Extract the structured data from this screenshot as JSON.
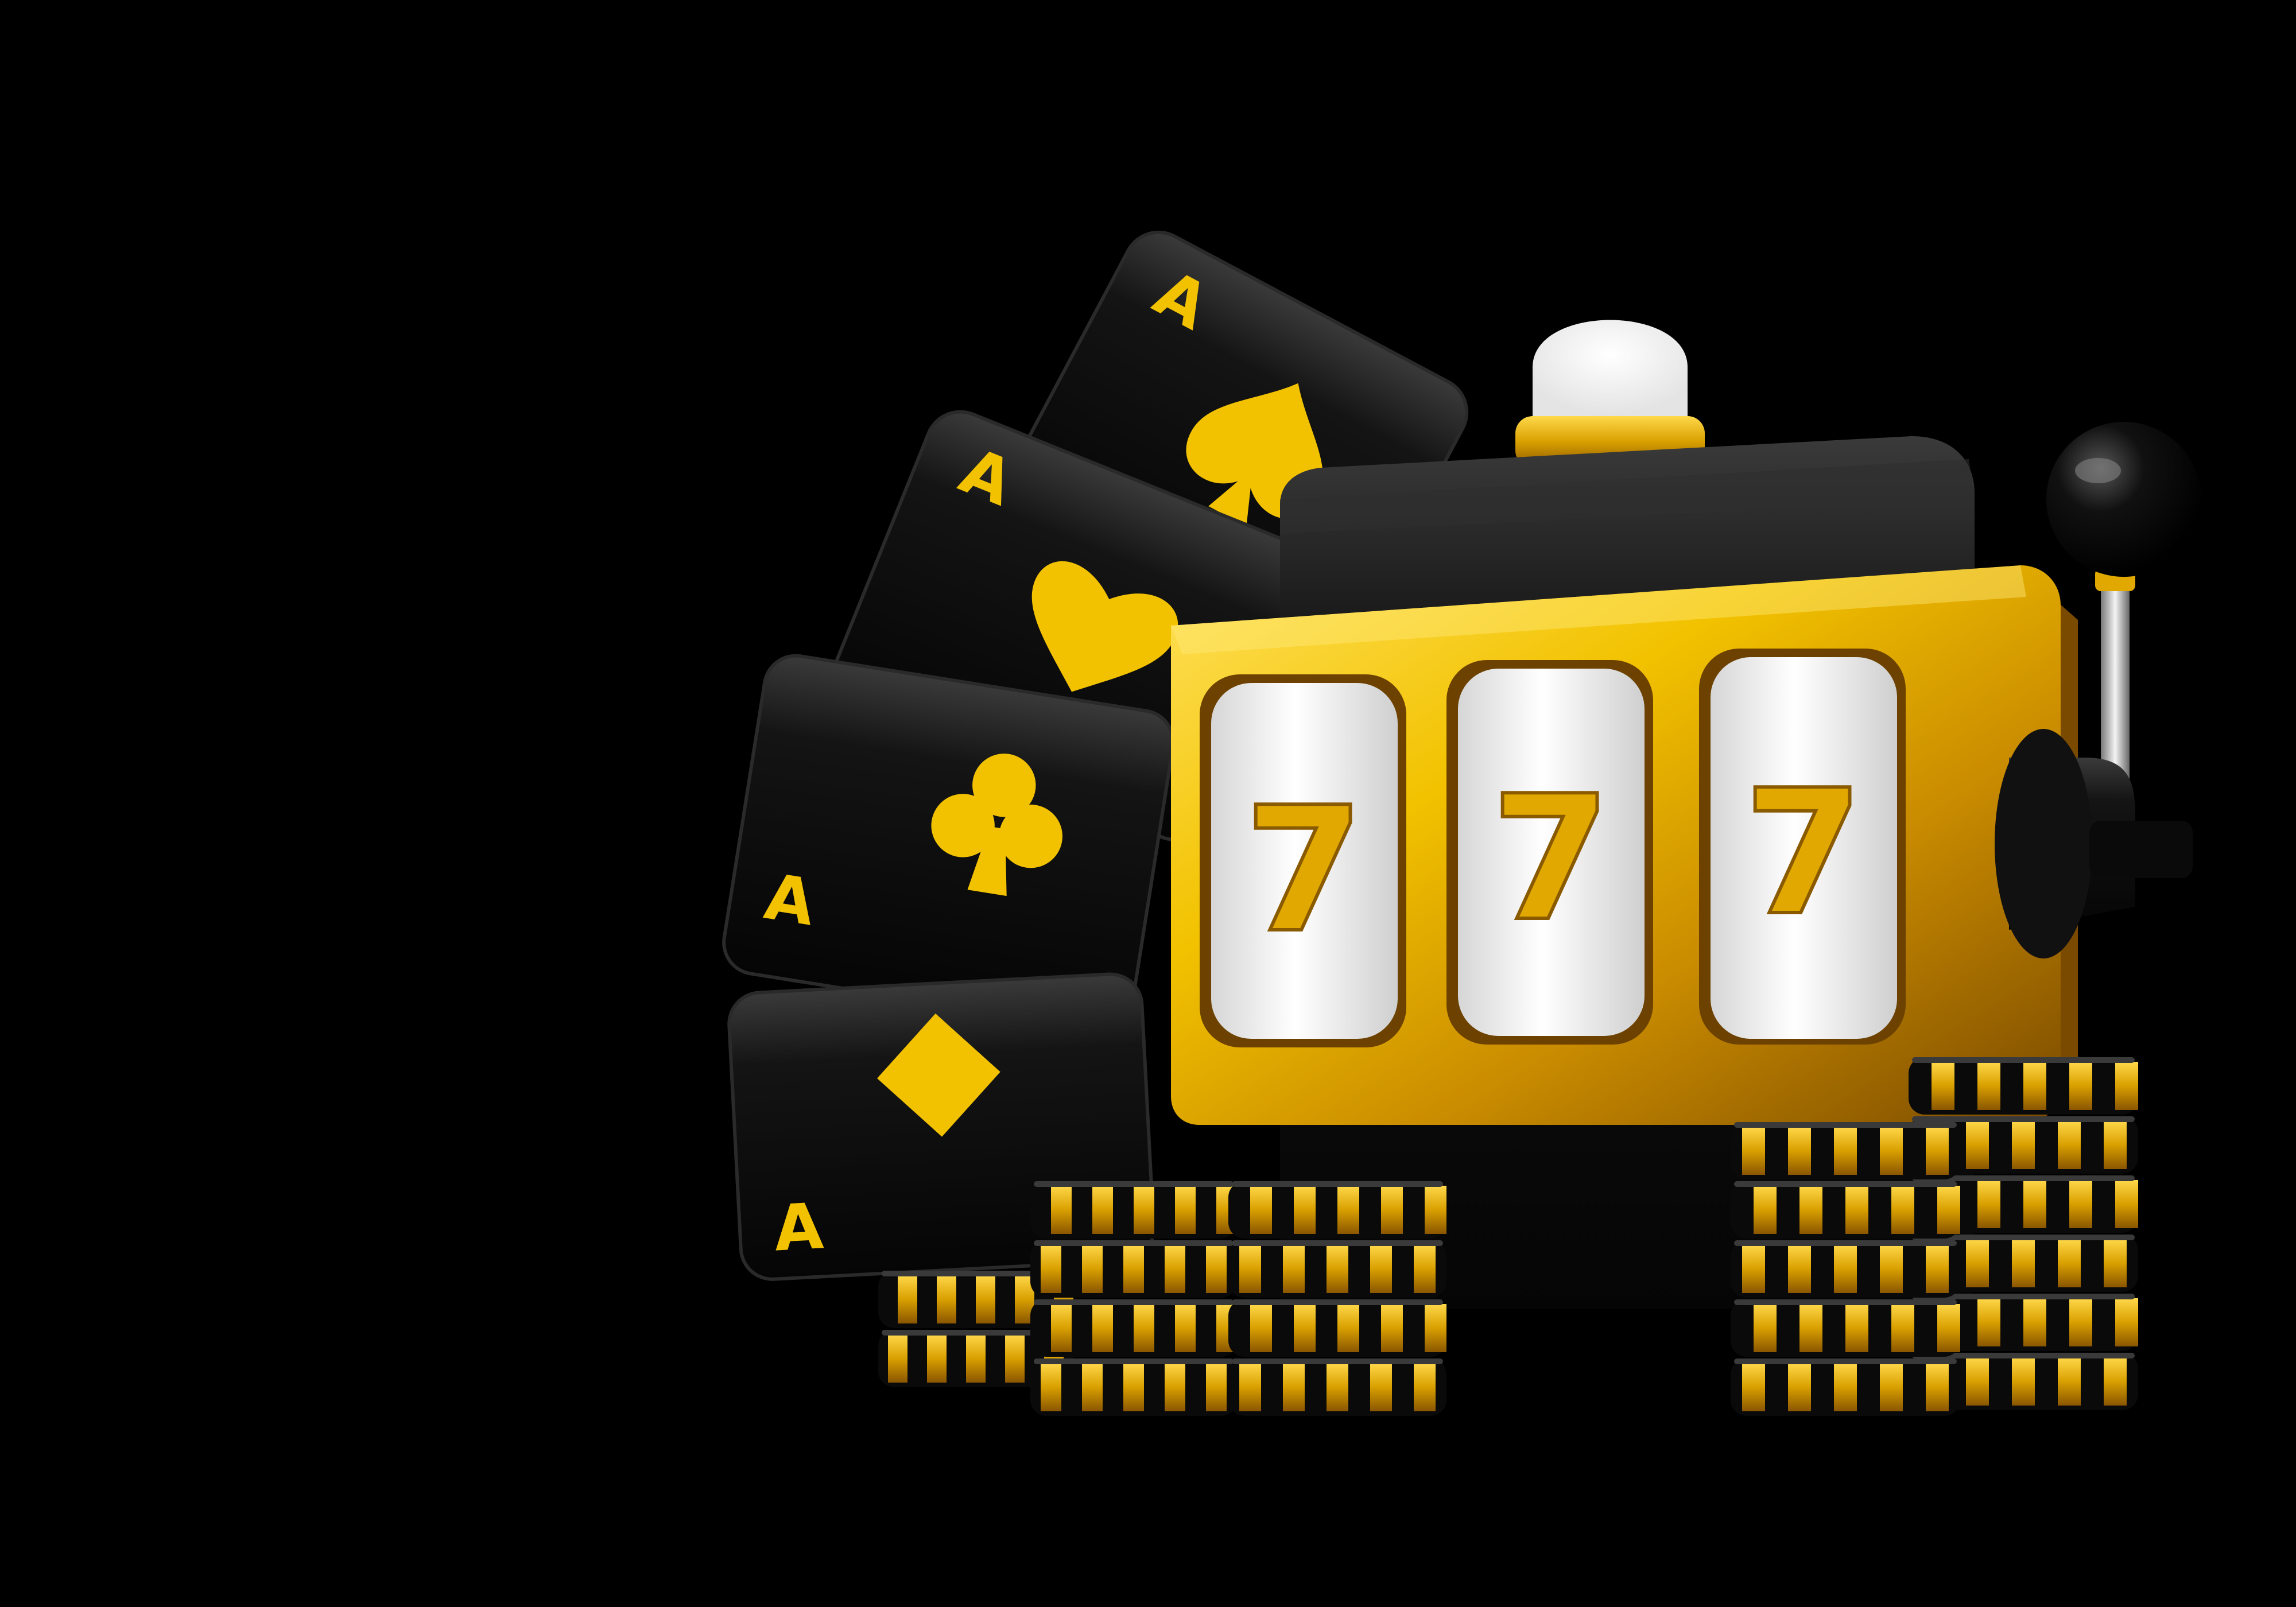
{
  "scene": {
    "background_color": "#000000",
    "subject": "slot-machine-with-aces-and-chips"
  },
  "colors": {
    "gold": "#f2c200",
    "gold_dark": "#a86f00",
    "card_black": "#111111",
    "reel_white": "#f2f2f2",
    "lamp_white": "#ffffff"
  },
  "cards": [
    {
      "rank": "A",
      "suit": "spade-icon"
    },
    {
      "rank": "A",
      "suit": "heart-icon"
    },
    {
      "rank": "A",
      "suit": "club-icon"
    },
    {
      "rank": "A",
      "suit": "diamond-icon"
    }
  ],
  "slot_machine": {
    "reels": [
      {
        "symbol": "7"
      },
      {
        "symbol": "7"
      },
      {
        "symbol": "7"
      }
    ],
    "lever_icon": "lever-knob-icon",
    "lamp_icon": "lamp-icon"
  },
  "chip_stacks": [
    {
      "name": "left-small",
      "count": 2
    },
    {
      "name": "left",
      "count": 4
    },
    {
      "name": "center",
      "count": 4
    },
    {
      "name": "right-front",
      "count": 5
    },
    {
      "name": "right-back",
      "count": 6
    }
  ]
}
